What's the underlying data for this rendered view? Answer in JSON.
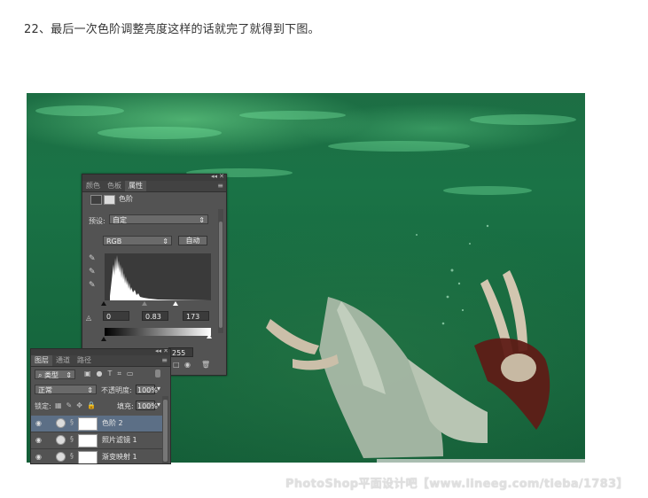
{
  "caption": "22、最后一次色阶调整亮度这样的话就完了就得到下图。",
  "watermark": "PhotoShop平面设计吧【www.lineeg.com/tieba/1783】",
  "properties_panel": {
    "tabs": [
      "颜色",
      "色板",
      "属性"
    ],
    "active_tab": "属性",
    "adjustment_title": "色阶",
    "preset_label": "预设:",
    "preset_value": "自定",
    "channel_value": "RGB",
    "auto_button": "自动",
    "input_levels": {
      "black": "0",
      "gamma": "0.83",
      "white": "173"
    },
    "output_levels": {
      "white": "255"
    }
  },
  "layers_panel": {
    "tabs": [
      "图层",
      "通道",
      "路径"
    ],
    "active_tab": "图层",
    "filter_label": "类型",
    "blend_mode": "正常",
    "opacity_label": "不透明度:",
    "opacity_value": "100%",
    "lock_label": "锁定:",
    "fill_label": "填充:",
    "fill_value": "100%",
    "layers": [
      {
        "name": "色阶 2",
        "selected": true
      },
      {
        "name": "照片滤镜 1",
        "selected": false
      },
      {
        "name": "渐变映射 1",
        "selected": false
      }
    ]
  },
  "icons": {
    "panel_menu": "menu-icon",
    "collapse": "double-arrow-icon",
    "close": "close-icon",
    "eye": "eye-icon",
    "eyedropper": "eyedropper-icon",
    "dropdown": "chevron-down-icon"
  },
  "colors": {
    "panel_bg": "#535353",
    "selected_layer": "#5c6f86",
    "water": "#1a7346"
  }
}
